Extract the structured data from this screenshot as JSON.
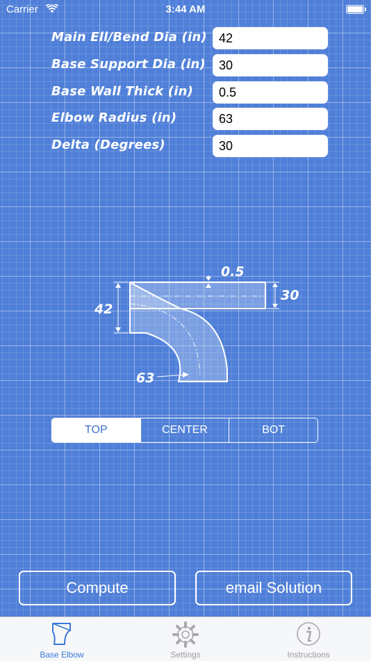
{
  "status_bar": {
    "carrier": "Carrier",
    "time": "3:44 AM"
  },
  "form": {
    "fields": [
      {
        "label": "Main Ell/Bend Dia (in)",
        "value": "42"
      },
      {
        "label": "Base Support Dia (in)",
        "value": "30"
      },
      {
        "label": "Base Wall Thick (in)",
        "value": "0.5"
      },
      {
        "label": "Elbow Radius (in)",
        "value": "63"
      },
      {
        "label": "Delta (Degrees)",
        "value": "30"
      }
    ]
  },
  "diagram": {
    "wall_thick": "0.5",
    "base_dia": "30",
    "main_dia": "42",
    "elbow_radius": "63"
  },
  "position_selector": {
    "options": [
      "TOP",
      "CENTER",
      "BOT"
    ],
    "selected": "TOP"
  },
  "actions": {
    "compute": "Compute",
    "email": "email Solution"
  },
  "tabbar": {
    "tabs": [
      {
        "label": "Base Elbow",
        "icon": "elbow-icon",
        "active": true
      },
      {
        "label": "Settings",
        "icon": "gear-icon",
        "active": false
      },
      {
        "label": "Instructions",
        "icon": "info-icon",
        "active": false
      }
    ]
  },
  "colors": {
    "background": "#4f7fd8",
    "tab_active": "#3a78d8",
    "tab_inactive": "#9a9a9e"
  }
}
